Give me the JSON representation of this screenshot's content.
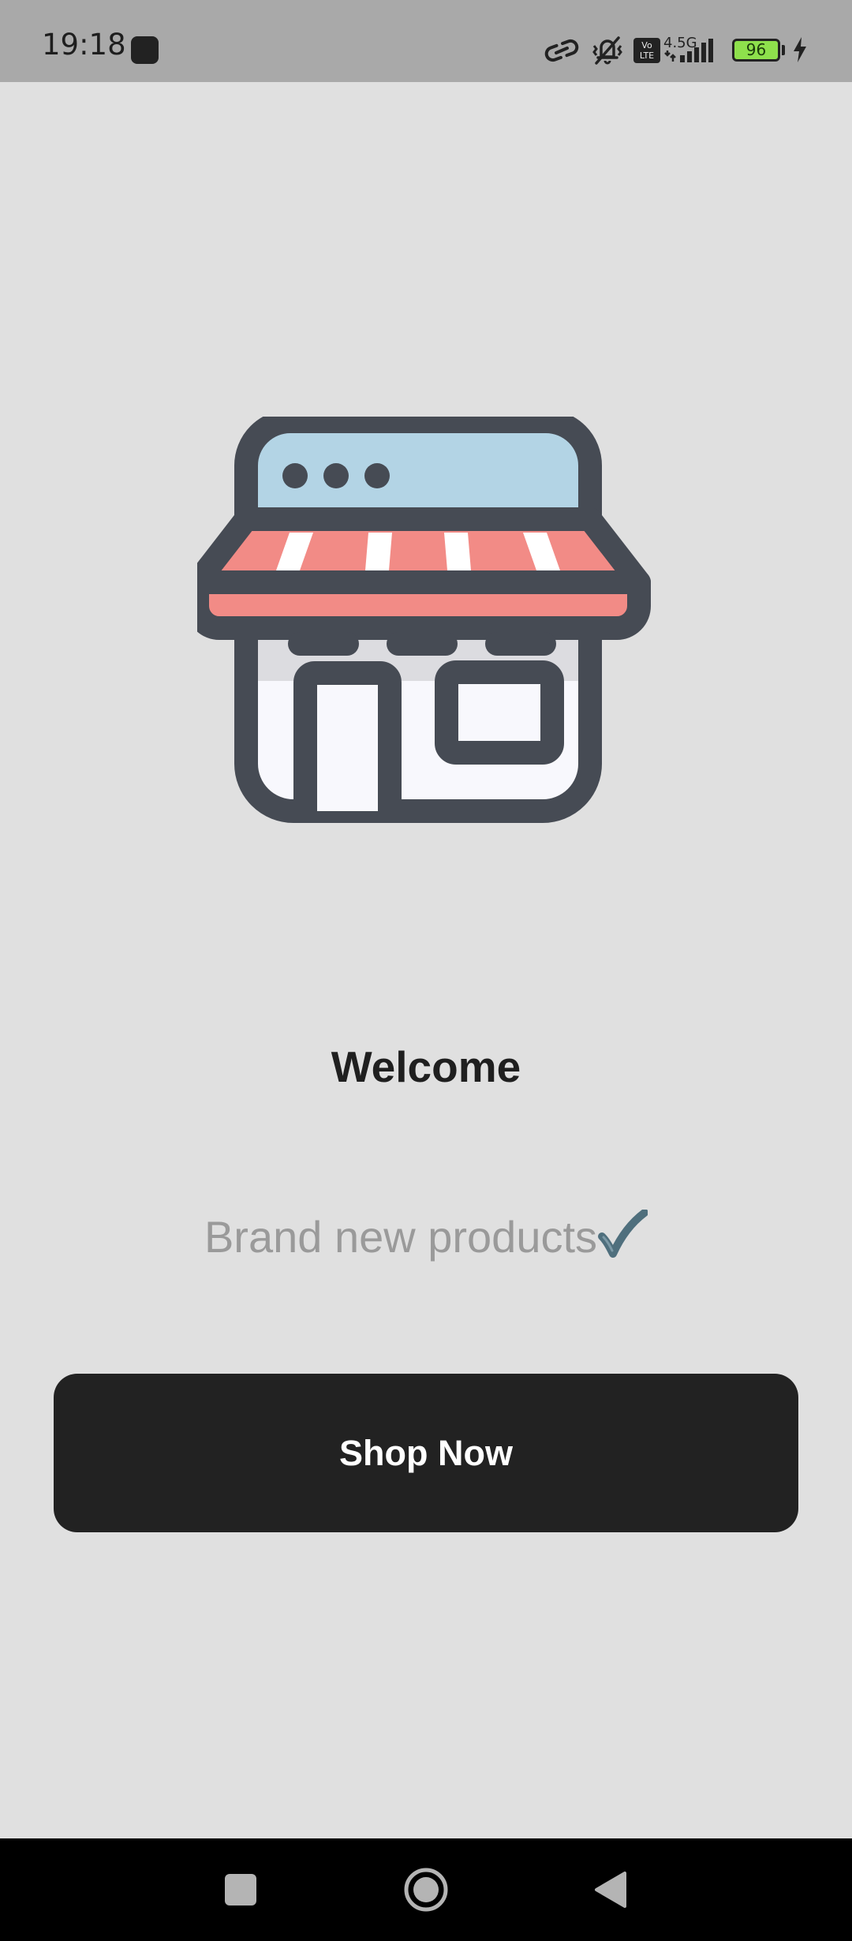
{
  "status_bar": {
    "time": "19:18",
    "network_type": "4.5G",
    "volte_label_top": "Vo",
    "volte_label_bottom": "LTE",
    "battery_level": "96"
  },
  "onboarding": {
    "illustration_icon": "storefront-icon",
    "title": "Welcome",
    "subtitle": "Brand new products",
    "subtitle_emoji_icon": "check-mark-icon",
    "cta_label": "Shop Now"
  },
  "colors": {
    "background": "#e0e0e0",
    "button": "#222222",
    "awning_stripe": "#f28b86",
    "roof": "#b3d4e5",
    "outline": "#464b54"
  },
  "nav_bar": {
    "buttons": [
      "recents-icon",
      "home-icon",
      "back-icon"
    ]
  }
}
